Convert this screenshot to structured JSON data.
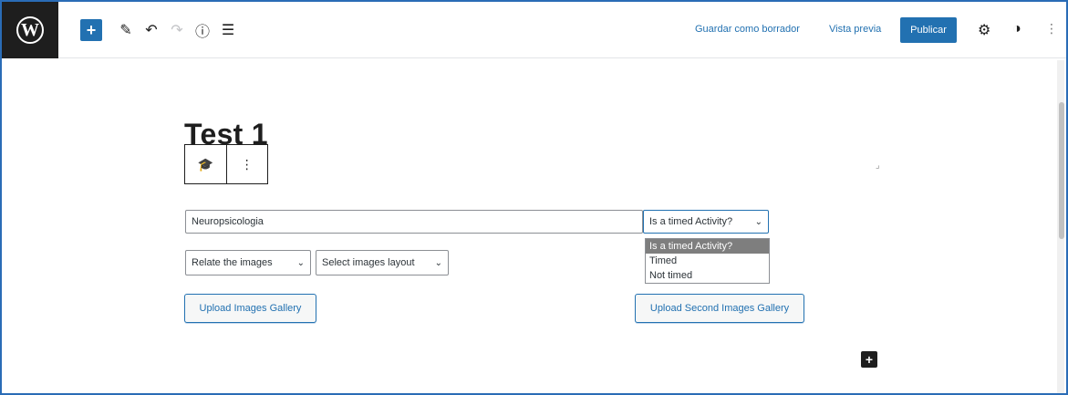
{
  "toolbar": {
    "logo_letter": "W",
    "add_symbol": "+",
    "pencil_icon": "✎",
    "undo_icon": "↶",
    "redo_icon": "↷",
    "info_icon": "ⓘ",
    "outline_icon": "☰",
    "save_draft_label": "Guardar como borrador",
    "preview_label": "Vista previa",
    "publish_label": "Publicar",
    "settings_icon": "⚙",
    "plugin_icon": "◑",
    "more_icon": "⋮"
  },
  "editor": {
    "post_title": "Test 1",
    "block_icon": "🎓",
    "block_more": "⋮",
    "category_input_value": "Neuropsicologia",
    "timed_select": {
      "selected": "Is a timed Activity?",
      "chevron": "⌄",
      "options": [
        "Is a timed Activity?",
        "Timed",
        "Not timed"
      ]
    },
    "relate_select": {
      "selected": "Relate the images",
      "chevron": "⌄"
    },
    "layout_select": {
      "selected": "Select images layout",
      "chevron": "⌄"
    },
    "upload_gallery_label": "Upload Images Gallery",
    "upload_second_gallery_label": "Upload Second Images Gallery",
    "add_block_symbol": "+",
    "resize_glyph": "⌟"
  },
  "colors": {
    "accent": "#2271b1",
    "logo_bg": "#1e1e1e",
    "frame_border": "#2a6cb6"
  }
}
